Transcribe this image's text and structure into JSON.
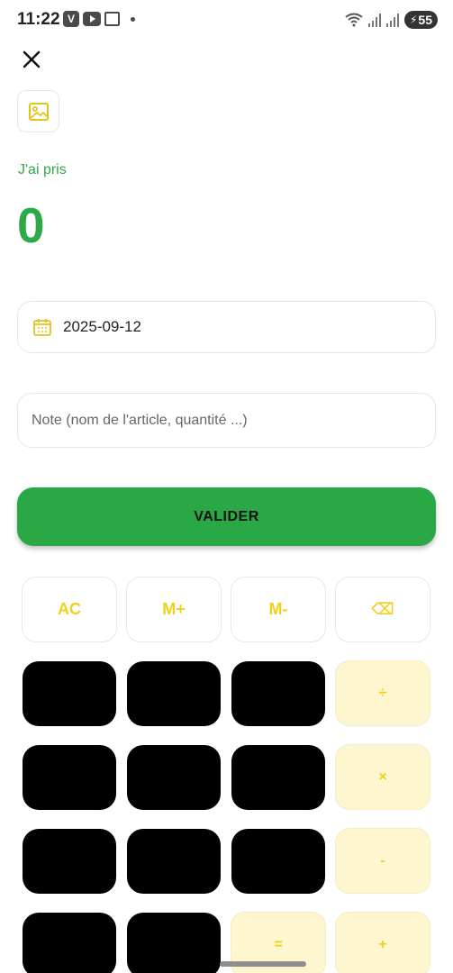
{
  "status_bar": {
    "time": "11:22",
    "app_badge": "V",
    "battery": "55",
    "icons": [
      "v-app-icon",
      "youtube-icon",
      "calendar-app-icon",
      "wifi-icon",
      "signal-icon",
      "signal-icon",
      "battery-icon"
    ]
  },
  "header": {
    "close_icon": "close-icon",
    "image_icon": "image-icon"
  },
  "entry": {
    "label": "J'ai pris",
    "amount": "0"
  },
  "date": {
    "value": "2025-09-12",
    "icon": "calendar-icon"
  },
  "note": {
    "placeholder": "Note (nom de l'article, quantité ...)",
    "value": ""
  },
  "validate": {
    "label": "VALIDER"
  },
  "keypad": {
    "function_keys": [
      "AC",
      "M+",
      "M-",
      "⌫"
    ],
    "operator_keys": [
      "÷",
      "×",
      "-",
      "=",
      "+"
    ]
  },
  "colors": {
    "accent_green": "#2aa846",
    "accent_yellow": "#f2cf1a",
    "operator_bg": "#fdf6cf",
    "number_key_bg": "#000000"
  }
}
